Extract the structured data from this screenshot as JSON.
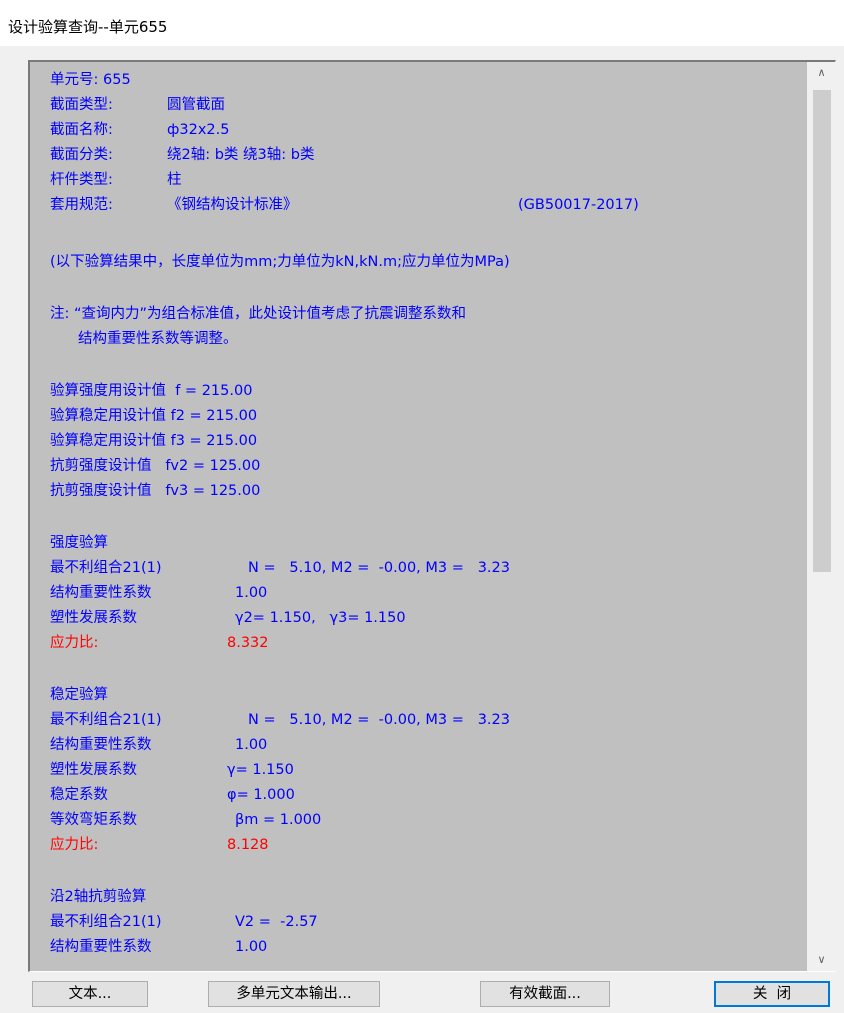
{
  "window": {
    "title": "设计验算查询--单元655"
  },
  "result_lines": [
    [
      "单元号: 655"
    ],
    [
      "截面类型:",
      "圆管截面"
    ],
    [
      "截面名称:",
      "ф32x2.5"
    ],
    [
      "截面分类:",
      "绕2轴: b类 绕3轴: b类"
    ],
    [
      "杆件类型:",
      "柱"
    ],
    [
      "套用规范:",
      "《钢结构设计标准》",
      "(GB50017-2017)"
    ],
    [
      "(以下验算结果中，长度单位为mm;力单位为kN,kN.m;应力单位为MPa)"
    ],
    [
      "注: “查询内力”为组合标准值，此处设计值考虑了抗震调整系数和"
    ],
    [
      "结构重要性系数等调整。"
    ],
    [
      "验算强度用设计值  f = 215.00"
    ],
    [
      "验算稳定用设计值 f2 = 215.00"
    ],
    [
      "验算稳定用设计值 f3 = 215.00"
    ],
    [
      "抗剪强度设计值   fv2 = 125.00"
    ],
    [
      "抗剪强度设计值   fv3 = 125.00"
    ],
    [
      "强度验算"
    ],
    [
      "最不利组合21(1)",
      "N =   5.10, M2 =  -0.00, M3 =   3.23"
    ],
    [
      "结构重要性系数",
      "1.00"
    ],
    [
      "塑性发展系数",
      "γ2= 1.150,   γ3= 1.150"
    ],
    [
      "应力比:",
      "8.332"
    ],
    [
      "稳定验算"
    ],
    [
      "最不利组合21(1)",
      "N =   5.10, M2 =  -0.00, M3 =   3.23"
    ],
    [
      "结构重要性系数",
      "1.00"
    ],
    [
      "塑性发展系数",
      "γ= 1.150"
    ],
    [
      "稳定系数",
      "φ= 1.000"
    ],
    [
      "等效弯矩系数",
      "βm = 1.000"
    ],
    [
      "应力比:",
      "8.128"
    ],
    [
      "沿2轴抗剪验算"
    ],
    [
      "最不利组合21(1)",
      "V2 =  -2.57"
    ],
    [
      "结构重要性系数",
      "1.00"
    ]
  ],
  "scrollbar": {
    "up_glyph": "∧",
    "down_glyph": "∨"
  },
  "buttons": {
    "text": "文本...",
    "multi_text_output": "多单元文本输出...",
    "effective_section": "有效截面...",
    "close": "关  闭"
  },
  "colors": {
    "text": "#0000ff",
    "highlight": "#ff0000",
    "panel": "#c0c0c0",
    "default_button_border": "#0078d7"
  }
}
